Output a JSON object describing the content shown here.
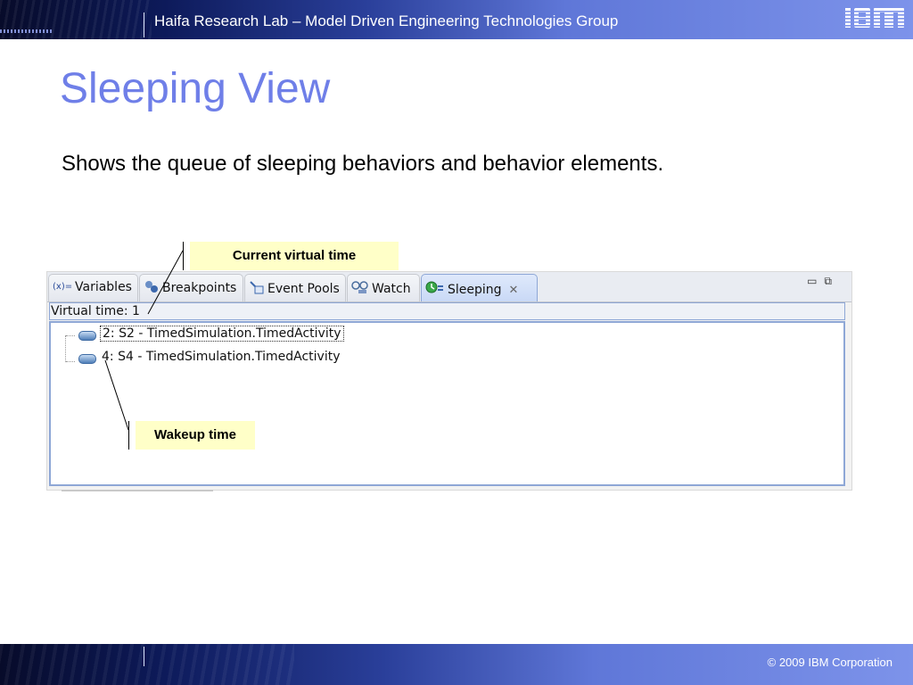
{
  "header": {
    "title": "Haifa Research Lab – Model Driven Engineering Technologies Group",
    "logo_text": "IBM"
  },
  "slide": {
    "title": "Sleeping View",
    "subtitle": "Shows the queue of sleeping behaviors and behavior elements."
  },
  "panel": {
    "tabs": [
      {
        "label": "Variables",
        "icon": "variables-icon"
      },
      {
        "label": "Breakpoints",
        "icon": "breakpoints-icon"
      },
      {
        "label": "Event Pools",
        "icon": "event-pools-icon"
      },
      {
        "label": "Watch",
        "icon": "watch-icon"
      },
      {
        "label": "Sleeping",
        "icon": "sleeping-icon",
        "active": true
      }
    ],
    "virtual_time_label": "Virtual time: 1",
    "items": [
      "2: S2 - TimedSimulation.TimedActivity",
      "4: S4 - TimedSimulation.TimedActivity"
    ]
  },
  "callouts": {
    "current_virtual_time": "Current virtual time",
    "wakeup_time": "Wakeup time"
  },
  "footer": {
    "copyright": "© 2009 IBM Corporation"
  },
  "colors": {
    "title": "#6f7fe8",
    "callout_bg": "#ffffc8",
    "header_start": "#070b2a",
    "header_end": "#7d93ea"
  }
}
